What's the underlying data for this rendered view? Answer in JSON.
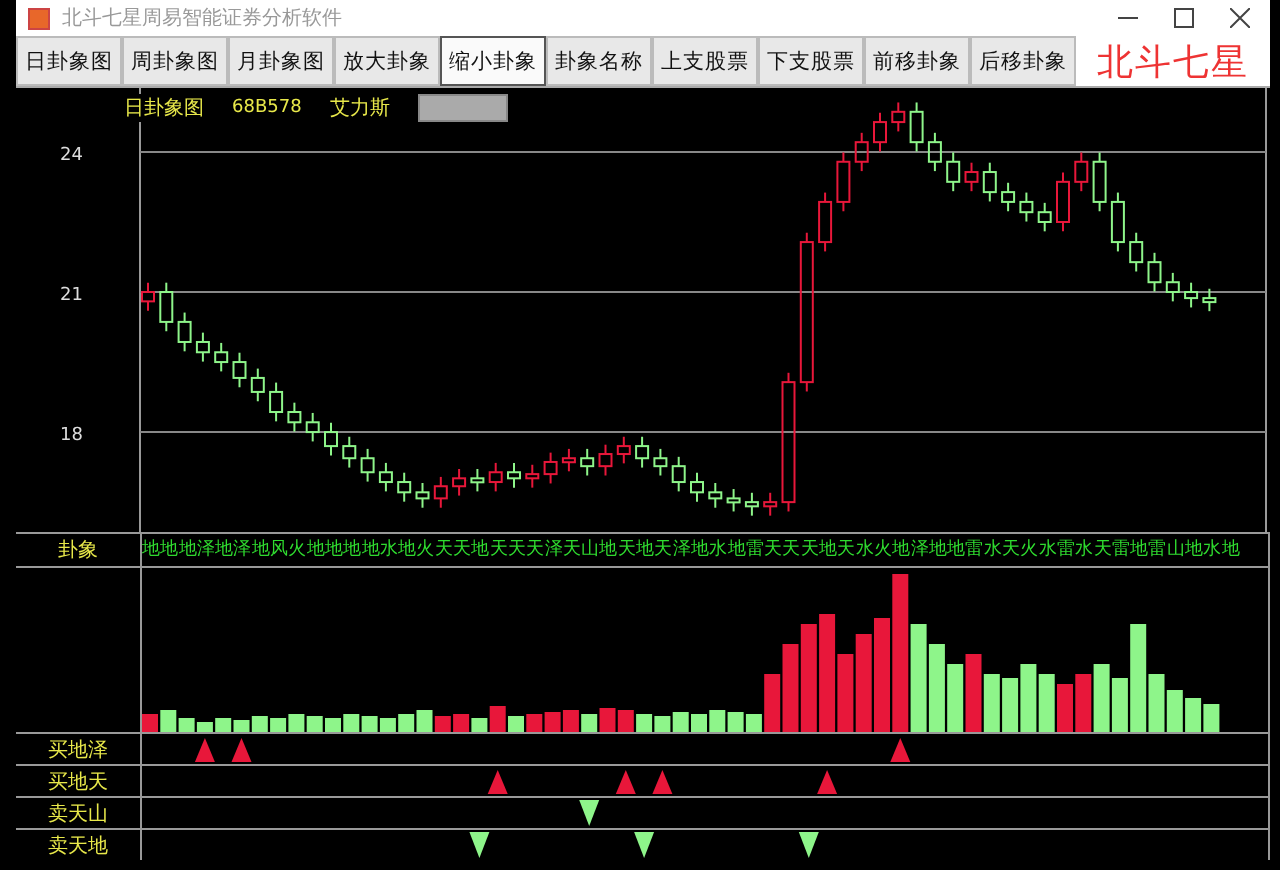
{
  "window": {
    "title": "北斗七星周易智能证券分析软件"
  },
  "toolbar": [
    {
      "label": "日卦象图",
      "selected": false
    },
    {
      "label": "周卦象图",
      "selected": false
    },
    {
      "label": "月卦象图",
      "selected": false
    },
    {
      "label": "放大卦象",
      "selected": false
    },
    {
      "label": "缩小卦象",
      "selected": true
    },
    {
      "label": "卦象名称",
      "selected": false
    },
    {
      "label": "上支股票",
      "selected": false
    },
    {
      "label": "下支股票",
      "selected": false
    },
    {
      "label": "前移卦象",
      "selected": false
    },
    {
      "label": "后移卦象",
      "selected": false
    }
  ],
  "brand": "北斗七星",
  "chart": {
    "period": "日卦象图",
    "code": "68B578",
    "name": "艾力斯",
    "chart_data": {
      "type": "candlestick",
      "grid": true,
      "ylim": [
        15.86,
        25.37
      ],
      "yticks": [
        24,
        21,
        18
      ],
      "ohlc": [
        [
          20.8,
          21.2,
          20.6,
          21.0
        ],
        [
          21.0,
          21.2,
          20.16,
          20.36
        ],
        [
          20.36,
          20.56,
          19.73,
          19.93
        ],
        [
          19.93,
          20.13,
          19.51,
          19.71
        ],
        [
          19.71,
          19.91,
          19.3,
          19.5
        ],
        [
          19.5,
          19.7,
          18.96,
          19.16
        ],
        [
          19.16,
          19.36,
          18.66,
          18.86
        ],
        [
          18.86,
          19.06,
          18.23,
          18.43
        ],
        [
          18.43,
          18.63,
          18.01,
          18.21
        ],
        [
          18.21,
          18.41,
          17.8,
          18.0
        ],
        [
          18.0,
          18.2,
          17.5,
          17.7
        ],
        [
          17.7,
          17.9,
          17.24,
          17.44
        ],
        [
          17.44,
          17.64,
          16.94,
          17.14
        ],
        [
          17.14,
          17.34,
          16.73,
          16.93
        ],
        [
          16.93,
          17.13,
          16.51,
          16.71
        ],
        [
          16.71,
          16.91,
          16.38,
          16.58
        ],
        [
          16.58,
          17.04,
          16.38,
          16.84
        ],
        [
          16.84,
          17.21,
          16.64,
          17.01
        ],
        [
          17.01,
          17.21,
          16.73,
          16.93
        ],
        [
          16.93,
          17.34,
          16.73,
          17.14
        ],
        [
          17.14,
          17.34,
          16.81,
          17.01
        ],
        [
          17.01,
          17.3,
          16.81,
          17.1
        ],
        [
          17.1,
          17.56,
          16.9,
          17.36
        ],
        [
          17.36,
          17.64,
          17.16,
          17.44
        ],
        [
          17.44,
          17.64,
          17.07,
          17.27
        ],
        [
          17.27,
          17.73,
          17.07,
          17.53
        ],
        [
          17.53,
          17.9,
          17.33,
          17.7
        ],
        [
          17.7,
          17.9,
          17.24,
          17.44
        ],
        [
          17.44,
          17.64,
          17.07,
          17.27
        ],
        [
          17.27,
          17.47,
          16.73,
          16.93
        ],
        [
          16.93,
          17.13,
          16.51,
          16.71
        ],
        [
          16.71,
          16.91,
          16.38,
          16.58
        ],
        [
          16.58,
          16.78,
          16.3,
          16.5
        ],
        [
          16.5,
          16.7,
          16.21,
          16.41
        ],
        [
          16.41,
          16.7,
          16.21,
          16.5
        ],
        [
          16.5,
          19.27,
          16.3,
          19.07
        ],
        [
          19.07,
          22.27,
          18.87,
          22.07
        ],
        [
          22.07,
          23.13,
          21.87,
          22.93
        ],
        [
          22.93,
          23.99,
          22.73,
          23.79
        ],
        [
          23.79,
          24.41,
          23.59,
          24.21
        ],
        [
          24.21,
          24.84,
          24.01,
          24.64
        ],
        [
          24.64,
          25.06,
          24.44,
          24.86
        ],
        [
          24.86,
          25.06,
          24.01,
          24.21
        ],
        [
          24.21,
          24.41,
          23.59,
          23.79
        ],
        [
          23.79,
          23.99,
          23.16,
          23.36
        ],
        [
          23.36,
          23.77,
          23.16,
          23.57
        ],
        [
          23.57,
          23.77,
          22.94,
          23.14
        ],
        [
          23.14,
          23.34,
          22.73,
          22.93
        ],
        [
          22.93,
          23.13,
          22.51,
          22.71
        ],
        [
          22.71,
          22.91,
          22.3,
          22.5
        ],
        [
          22.5,
          23.56,
          22.3,
          23.36
        ],
        [
          23.36,
          23.99,
          23.16,
          23.79
        ],
        [
          23.79,
          23.99,
          22.73,
          22.93
        ],
        [
          22.93,
          23.13,
          21.87,
          22.07
        ],
        [
          22.07,
          22.27,
          21.44,
          21.64
        ],
        [
          21.64,
          21.84,
          21.01,
          21.21
        ],
        [
          21.21,
          21.41,
          20.8,
          21.0
        ],
        [
          21.0,
          21.2,
          20.67,
          20.87
        ],
        [
          20.87,
          21.07,
          20.59,
          20.79
        ]
      ]
    }
  },
  "hexagram_row": {
    "label": "卦象",
    "symbols": "地地地泽地泽地风火地地地地水地火天天地天天天泽天山地天地天泽地水地雷天天天地天水火地泽地地雷水天火水雷水天雷地雷山地水地"
  },
  "signals": [
    {
      "label": "买地泽",
      "kind": "buy"
    },
    {
      "label": "买地天",
      "kind": "buy"
    },
    {
      "label": "卖天山",
      "kind": "sell"
    },
    {
      "label": "卖天地",
      "kind": "sell"
    }
  ]
}
